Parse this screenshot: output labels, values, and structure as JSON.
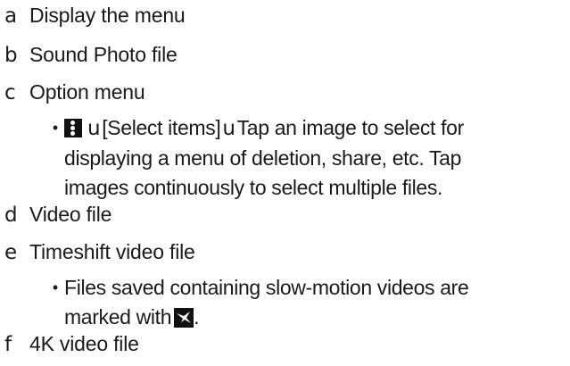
{
  "items": [
    {
      "letter": "a",
      "label": "Display the menu"
    },
    {
      "letter": "b",
      "label": "Sound Photo file"
    },
    {
      "letter": "c",
      "label": "Option menu",
      "sub": {
        "bullet": "•",
        "icon": "vertical-dots-menu-icon",
        "sep1": "u",
        "title": "[Select items]",
        "sep2": "u",
        "lines": [
          "Tap an image to select for",
          "displaying a menu of deletion, share, etc. Tap",
          "images continuously to select multiple files."
        ]
      }
    },
    {
      "letter": "d",
      "label": "Video file"
    },
    {
      "letter": "e",
      "label": "Timeshift video file",
      "sub": {
        "bullet": "•",
        "lines": [
          "Files saved containing slow-motion videos are",
          "marked with"
        ],
        "icon": "slow-motion-bird-icon",
        "tail": "."
      }
    },
    {
      "letter": "f",
      "label": "4K video file"
    }
  ]
}
